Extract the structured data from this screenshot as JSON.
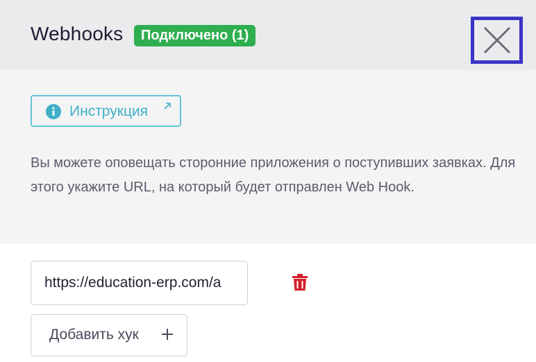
{
  "header": {
    "title": "Webhooks",
    "badge": "Подключено (1)",
    "close_icon": "close-icon"
  },
  "instruction": {
    "label": "Инструкция",
    "info_icon": "info-icon",
    "external_icon": "external-link-icon"
  },
  "description": "Вы можете оповещать сторонние приложения о поступивших заявках. Для этого укажите URL, на который будет отправлен Web Hook.",
  "webhooks": [
    {
      "url": "https://education-erp.com/a",
      "delete_icon": "trash-icon"
    }
  ],
  "add_button": {
    "label": "Добавить хук",
    "icon": "plus-icon"
  },
  "colors": {
    "badge": "#2fae4f",
    "accent": "#3fafc7",
    "delete": "#d0202a",
    "focus_outline": "#3a34c8"
  }
}
